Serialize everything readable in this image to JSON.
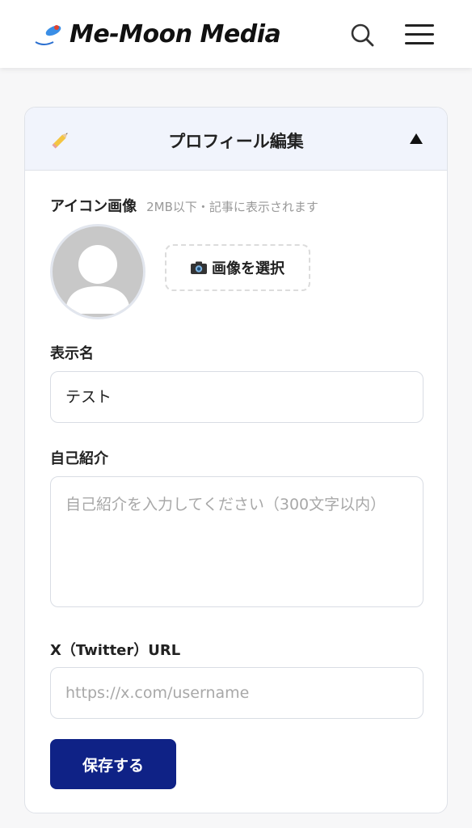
{
  "header": {
    "brand": "Me-Moon Media",
    "search_icon": "search-icon",
    "menu_icon": "hamburger-icon"
  },
  "profile_edit": {
    "title": "プロフィール編集",
    "collapse_icon": "caret-up-icon",
    "icon_image": {
      "label": "アイコン画像",
      "hint": "2MB以下・記事に表示されます",
      "select_button": "画像を選択"
    },
    "display_name": {
      "label": "表示名",
      "value": "テスト"
    },
    "bio": {
      "label": "自己紹介",
      "value": "",
      "placeholder": "自己紹介を入力してください（300文字以内）"
    },
    "x_url": {
      "label": "X（Twitter）URL",
      "value": "",
      "placeholder": "https://x.com/username"
    },
    "save_label": "保存する"
  },
  "colors": {
    "accent": "#0f2286",
    "header_band": "#f1f4fc"
  }
}
